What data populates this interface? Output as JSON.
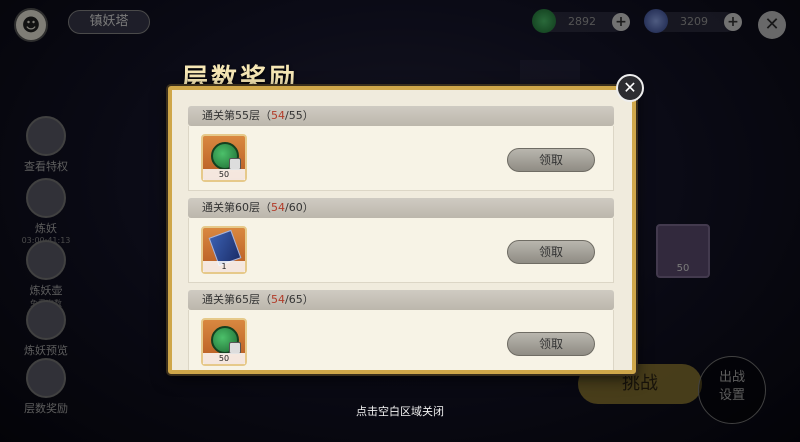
{
  "header": {
    "title": "镇妖塔",
    "resources": [
      {
        "icon": "jade-coin-icon",
        "value": "2892",
        "color": "#3aa65a"
      },
      {
        "icon": "gem-icon",
        "value": "3209",
        "color": "#5d76c9"
      }
    ]
  },
  "sidebar": {
    "items": [
      {
        "label": "查看特权",
        "sub": ""
      },
      {
        "label": "炼妖",
        "sub": "03:00:41:13"
      },
      {
        "label": "炼妖壶",
        "sub": "免费次数"
      },
      {
        "label": "炼妖预览",
        "sub": ""
      },
      {
        "label": "层数奖励",
        "sub": ""
      }
    ]
  },
  "background": {
    "right_slot_count": "50",
    "deploy_label": "出战\n设置",
    "challenge_label": "挑战"
  },
  "modal": {
    "title": "层数奖励",
    "entries": [
      {
        "label_prefix": "通关第55层（",
        "current": "54",
        "target_text": "/55",
        "label_suffix": "）",
        "item": "jade-coin",
        "count": "50",
        "locked": true,
        "button": "领取"
      },
      {
        "label_prefix": "通关第60层（",
        "current": "54",
        "target_text": "/60",
        "label_suffix": "）",
        "item": "card-scroll",
        "count": "1",
        "locked": false,
        "button": "领取"
      },
      {
        "label_prefix": "通关第65层（",
        "current": "54",
        "target_text": "/65",
        "label_suffix": "）",
        "item": "jade-coin",
        "count": "50",
        "locked": true,
        "button": "领取"
      }
    ]
  },
  "hint": "点击空白区域关闭"
}
